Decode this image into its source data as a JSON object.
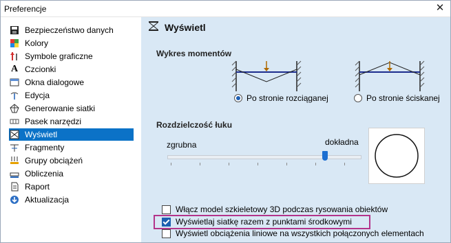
{
  "window": {
    "title": "Preferencje"
  },
  "sidebar": {
    "items": [
      {
        "label": "Bezpieczeństwo danych",
        "icon": "floppy-disk-icon"
      },
      {
        "label": "Kolory",
        "icon": "color-palette-icon"
      },
      {
        "label": "Symbole graficzne",
        "icon": "graphic-symbols-icon"
      },
      {
        "label": "Czcionki",
        "icon": "font-letter-icon"
      },
      {
        "label": "Okna dialogowe",
        "icon": "dialog-window-icon"
      },
      {
        "label": "Edycja",
        "icon": "edit-icon"
      },
      {
        "label": "Generowanie siatki",
        "icon": "mesh-icon"
      },
      {
        "label": "Pasek narzędzi",
        "icon": "toolbar-icon"
      },
      {
        "label": "Wyświetl",
        "icon": "display-icon",
        "selected": true
      },
      {
        "label": "Fragmenty",
        "icon": "fragments-icon"
      },
      {
        "label": "Grupy obciążeń",
        "icon": "load-groups-icon"
      },
      {
        "label": "Obliczenia",
        "icon": "calculations-icon"
      },
      {
        "label": "Raport",
        "icon": "report-icon"
      },
      {
        "label": "Aktualizacja",
        "icon": "update-icon"
      }
    ]
  },
  "panel": {
    "header": {
      "label": "Wyświetl",
      "icon": "display-icon"
    },
    "moment_chart": {
      "title": "Wykres momentów",
      "options": [
        {
          "label": "Po stronie rozciąganej",
          "selected": true
        },
        {
          "label": "Po stronie ściskanej",
          "selected": false
        }
      ]
    },
    "arc_resolution": {
      "title": "Rozdzielczość łuku",
      "left_label": "zgrubna",
      "right_label": "dokładna",
      "level_fraction": 0.83
    },
    "checkboxes": [
      {
        "label": "Włącz model szkieletowy 3D podczas rysowania obiektów",
        "checked": false
      },
      {
        "label": "Wyświetlaj siatkę razem z punktami środkowymi",
        "checked": true,
        "highlighted": true
      },
      {
        "label": "Wyświetl obciążenia liniowe na wszystkich połączonych elementach",
        "checked": false
      }
    ]
  },
  "colors": {
    "selection": "#0b72c7",
    "panel_bg": "#d9e8f5",
    "highlight": "#b3338a",
    "accent": "#1b5fb0"
  }
}
